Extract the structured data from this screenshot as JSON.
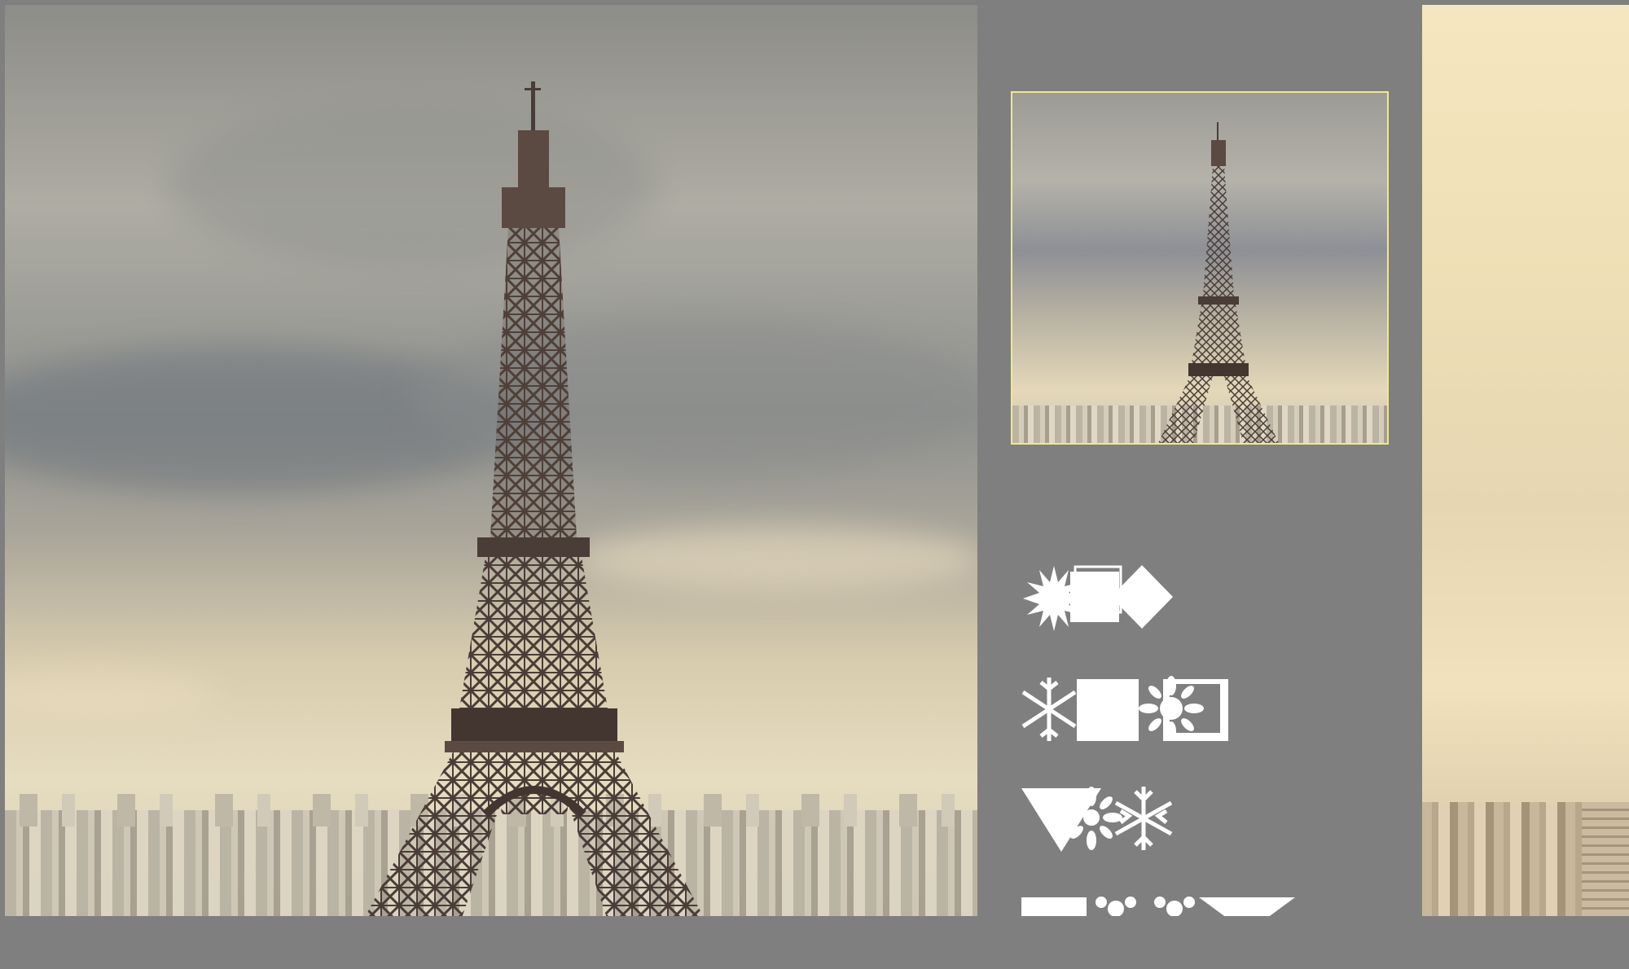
{
  "screen": {
    "background": "#7f7f7f",
    "thumbnail_border_color": "#f1e98a",
    "glyph_color": "#ffffff"
  },
  "main_photo": {
    "subject": "eiffel-tower-photo"
  },
  "thumbnail": {
    "subject": "eiffel-tower-thumbnail"
  },
  "side_photo": {
    "subject": "paris-skyline-photo"
  },
  "captcha_glyph_rows": [
    {
      "glyphs": [
        "starburst-icon",
        "square-icon",
        "diamond-icon"
      ]
    },
    {
      "glyphs": [
        "snowflake-icon",
        "square-icon",
        "flower-icon"
      ]
    },
    {
      "glyphs": [
        "triangle-icon",
        "flower-icon",
        "snowflake-icon"
      ]
    },
    {
      "glyphs": [
        "square-icon",
        "flower-icon",
        "flower-icon",
        "triangle-icon"
      ]
    }
  ]
}
